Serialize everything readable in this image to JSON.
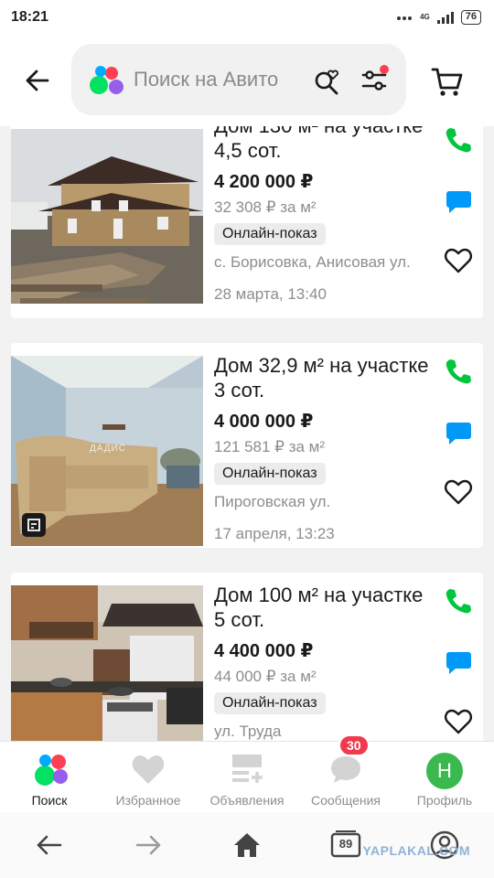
{
  "status_bar": {
    "time": "18:21",
    "network": "4G",
    "battery": "76"
  },
  "header": {
    "search_placeholder": "Поиск на Авито"
  },
  "listings": [
    {
      "title": "Дом 130 м² на участке 4,5 сот.",
      "price": "4 200 000 ₽",
      "price_per_m2": "32 308 ₽ за м²",
      "badge": "Онлайн-показ",
      "address": "с. Борисовка, Анисовая ул.",
      "date": "28 марта, 13:40"
    },
    {
      "title": "Дом 32,9 м² на участке 3 сот.",
      "price": "4 000 000 ₽",
      "price_per_m2": "121 581 ₽ за м²",
      "badge": "Онлайн-показ",
      "address": "Пироговская ул.",
      "date": "17 апреля, 13:23",
      "photo_watermark": "ДАДИС"
    },
    {
      "title": "Дом 100 м² на участке 5 сот.",
      "price": "4 400 000 ₽",
      "price_per_m2": "44 000 ₽ за м²",
      "badge": "Онлайн-показ",
      "address": "ул. Труда",
      "date": ""
    }
  ],
  "tabbar": {
    "items": [
      {
        "label": "Поиск"
      },
      {
        "label": "Избранное"
      },
      {
        "label": "Объявления"
      },
      {
        "label": "Сообщения",
        "badge": "30"
      },
      {
        "label": "Профиль",
        "avatar_letter": "Н"
      }
    ]
  },
  "system_nav": {
    "tabs_count": "89"
  },
  "watermark": "YAPLAKAL.COM",
  "colors": {
    "call": "#00c53d",
    "message": "#0099f7",
    "avito_green": "#04e061",
    "avito_blue": "#0af",
    "avito_red": "#ff4053",
    "avito_purple": "#965eeb",
    "badge_red": "#f03a4f",
    "avatar_green": "#3aba4e"
  }
}
